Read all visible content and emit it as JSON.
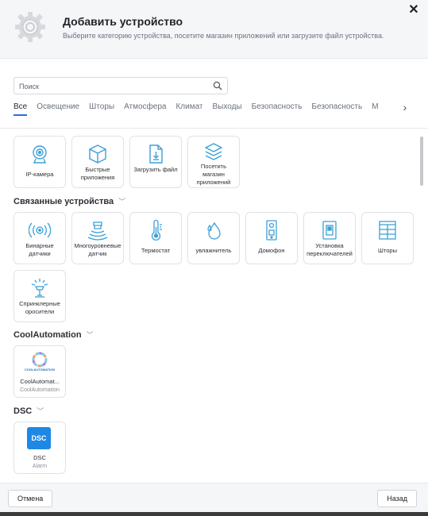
{
  "header": {
    "title": "Добавить устройство",
    "subtitle": "Выберите категорию устройства, посетите магазин приложений или загрузите файл устройства.",
    "close_label": "✕"
  },
  "search": {
    "placeholder": "Поиск",
    "value": ""
  },
  "tabs": [
    {
      "label": "Все",
      "active": true
    },
    {
      "label": "Освещение"
    },
    {
      "label": "Шторы"
    },
    {
      "label": "Атмосфера"
    },
    {
      "label": "Климат"
    },
    {
      "label": "Выходы"
    },
    {
      "label": "Безопасность"
    },
    {
      "label": "Безопасность"
    },
    {
      "label": "М"
    }
  ],
  "tabs_arrow": "›",
  "quick_actions": [
    {
      "label": "IP-камера",
      "icon": "camera-icon"
    },
    {
      "label": "Быстрые приложения",
      "icon": "cube-icon"
    },
    {
      "label": "Загрузить файл",
      "icon": "file-upload-icon"
    },
    {
      "label": "Посетить магазин приложений",
      "icon": "layers-icon"
    }
  ],
  "sections": {
    "connected": {
      "title": "Связанные устройства",
      "items": [
        {
          "label": "Бинарные датчики",
          "icon": "binary-sensor-icon"
        },
        {
          "label": "Многоуровневые датчик",
          "icon": "multilevel-sensor-icon"
        },
        {
          "label": "Термостат",
          "icon": "thermostat-icon"
        },
        {
          "label": "увлажнитель",
          "icon": "humidifier-icon"
        },
        {
          "label": "Домофон",
          "icon": "intercom-icon"
        },
        {
          "label": "Установка переключателей",
          "icon": "switch-icon"
        },
        {
          "label": "Шторы",
          "icon": "blinds-icon"
        },
        {
          "label": "Спринклерные оросители",
          "icon": "sprinkler-icon"
        }
      ]
    },
    "coolautomation": {
      "title": "CoolAutomation",
      "items": [
        {
          "label": "CoolAutomat...",
          "sub": "CoolAutomation",
          "logo_text": "COOLAUTOMATION"
        }
      ]
    },
    "dsc": {
      "title": "DSC",
      "items": [
        {
          "label": "DSC",
          "sub": "Alarm",
          "logo_text": "DSC"
        }
      ]
    }
  },
  "footer": {
    "cancel_label": "Отмена",
    "back_label": "Назад"
  },
  "colors": {
    "accent": "#2d6cdf",
    "icon": "#3aa0d8",
    "dsc": "#1e88e5"
  }
}
